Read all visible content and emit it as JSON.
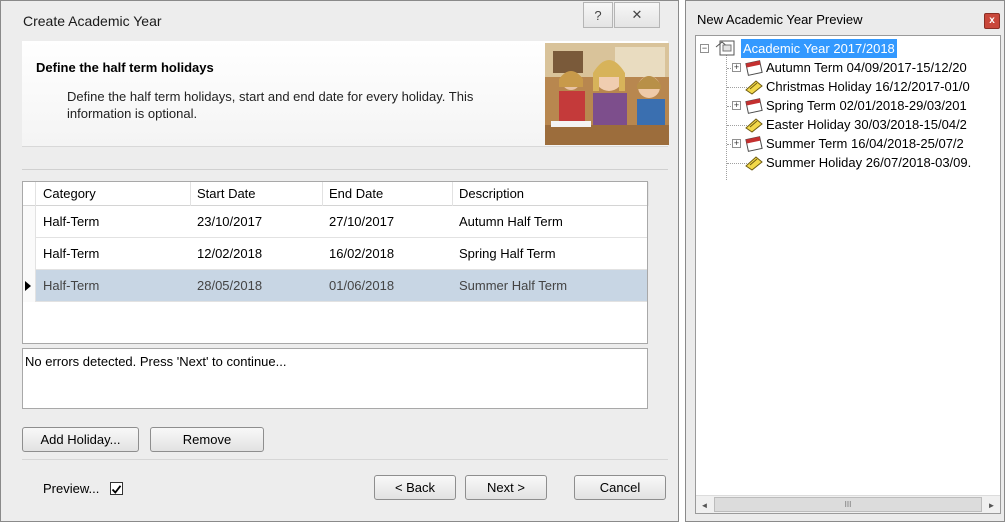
{
  "dialog": {
    "title": "Create Academic Year",
    "help_glyph": "?",
    "close_glyph": "✕",
    "header": {
      "title": "Define the half term holidays",
      "description": "Define the half term holidays, start and end date for every holiday. This information is optional."
    },
    "grid": {
      "columns": [
        "Category",
        "Start Date",
        "End Date",
        "Description"
      ],
      "rows": [
        {
          "category": "Half-Term",
          "start": "23/10/2017",
          "end": "27/10/2017",
          "description": "Autumn Half Term"
        },
        {
          "category": "Half-Term",
          "start": "12/02/2018",
          "end": "16/02/2018",
          "description": "Spring Half Term"
        },
        {
          "category": "Half-Term",
          "start": "28/05/2018",
          "end": "01/06/2018",
          "description": "Summer Half Term"
        }
      ],
      "selected_row": 2
    },
    "status": "No errors detected. Press 'Next' to continue...",
    "buttons": {
      "add": "Add Holiday...",
      "remove": "Remove",
      "back": "< Back",
      "next": "Next >",
      "cancel": "Cancel"
    },
    "preview": {
      "label": "Preview...",
      "checked": true
    }
  },
  "preview_panel": {
    "title": "New Academic Year Preview",
    "close_glyph": "x",
    "tree": {
      "root": {
        "label": "Academic Year 2017/2018",
        "expander": "−"
      },
      "items": [
        {
          "label": "Autumn Term 04/09/2017-15/12/20",
          "expander": "+",
          "icon": "calendar-icon"
        },
        {
          "label": "Christmas Holiday 16/12/2017-01/0",
          "expander": "",
          "icon": "holiday-icon"
        },
        {
          "label": "Spring Term 02/01/2018-29/03/201",
          "expander": "+",
          "icon": "calendar-icon"
        },
        {
          "label": "Easter Holiday 30/03/2018-15/04/2",
          "expander": "",
          "icon": "holiday-icon"
        },
        {
          "label": "Summer Term 16/04/2018-25/07/2",
          "expander": "+",
          "icon": "calendar-icon"
        },
        {
          "label": "Summer Holiday 26/07/2018-03/09.",
          "expander": "",
          "icon": "holiday-icon"
        }
      ]
    },
    "scrollbar": {
      "left_glyph": "◄",
      "right_glyph": "►",
      "thumb_glyph": "III"
    }
  }
}
